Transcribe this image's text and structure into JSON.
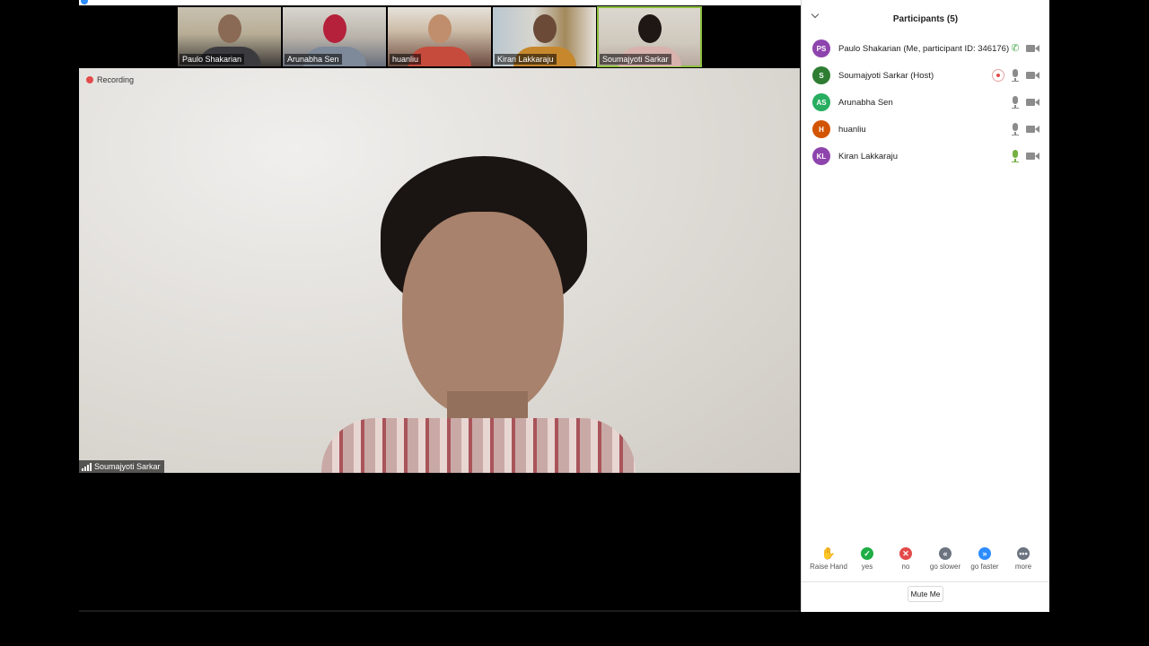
{
  "thumbnails": [
    {
      "name": "Paulo Shakarian",
      "active": false
    },
    {
      "name": "Arunabha Sen",
      "active": false
    },
    {
      "name": "huanliu",
      "active": false
    },
    {
      "name": "Kiran Lakkaraju",
      "active": false
    },
    {
      "name": "Soumajyoti Sarkar",
      "active": true
    }
  ],
  "main_video": {
    "recording_label": "Recording",
    "speaker_name": "Soumajyoti Sarkar"
  },
  "participants_panel": {
    "title": "Participants (5)",
    "participants": [
      {
        "initials": "PS",
        "name": "Paulo Shakarian (Me, participant ID: 346176)",
        "avatar_color": "#8e44ad",
        "audio": "phone",
        "video_icon": "camera-icon"
      },
      {
        "initials": "S",
        "name": "Soumajyoti Sarkar (Host)",
        "avatar_color": "#2e7d32",
        "audio": "muted",
        "recording": true,
        "video_icon": "camera-icon"
      },
      {
        "initials": "AS",
        "name": "Arunabha Sen",
        "avatar_color": "#27ae60",
        "audio": "muted",
        "video_icon": "camera-icon"
      },
      {
        "initials": "H",
        "name": "huanliu",
        "avatar_color": "#d35400",
        "audio": "muted",
        "video_icon": "camera-icon"
      },
      {
        "initials": "KL",
        "name": "Kiran Lakkaraju",
        "avatar_color": "#8e44ad",
        "audio": "speaking",
        "video_icon": "camera-icon"
      }
    ],
    "reactions": [
      {
        "label": "Raise Hand",
        "icon": "raise-hand-icon",
        "color": "#2d8cff"
      },
      {
        "label": "yes",
        "icon": "check-icon",
        "color": "#1fae45"
      },
      {
        "label": "no",
        "icon": "x-icon",
        "color": "#e34a4a"
      },
      {
        "label": "go slower",
        "icon": "rewind-icon",
        "color": "#6c7480"
      },
      {
        "label": "go faster",
        "icon": "fast-forward-icon",
        "color": "#2d8cff"
      },
      {
        "label": "more",
        "icon": "more-icon",
        "color": "#6c7480"
      }
    ],
    "mute_button": "Mute Me"
  }
}
